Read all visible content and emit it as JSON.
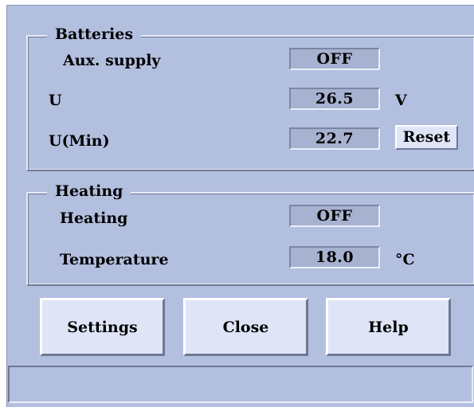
{
  "batteries": {
    "legend": "Batteries",
    "aux_supply": {
      "label": "Aux. supply",
      "value": "OFF"
    },
    "u": {
      "label": "U",
      "value": "26.5",
      "unit": "V"
    },
    "u_min": {
      "label": "U(Min)",
      "value": "22.7",
      "reset_label": "Reset"
    }
  },
  "heating": {
    "legend": "Heating",
    "heating": {
      "label": "Heating",
      "value": "OFF"
    },
    "temperature": {
      "label": "Temperature",
      "value": "18.0",
      "unit": "°C"
    }
  },
  "buttons": {
    "settings": "Settings",
    "close": "Close",
    "help": "Help"
  },
  "status_bar": {
    "text": ""
  }
}
